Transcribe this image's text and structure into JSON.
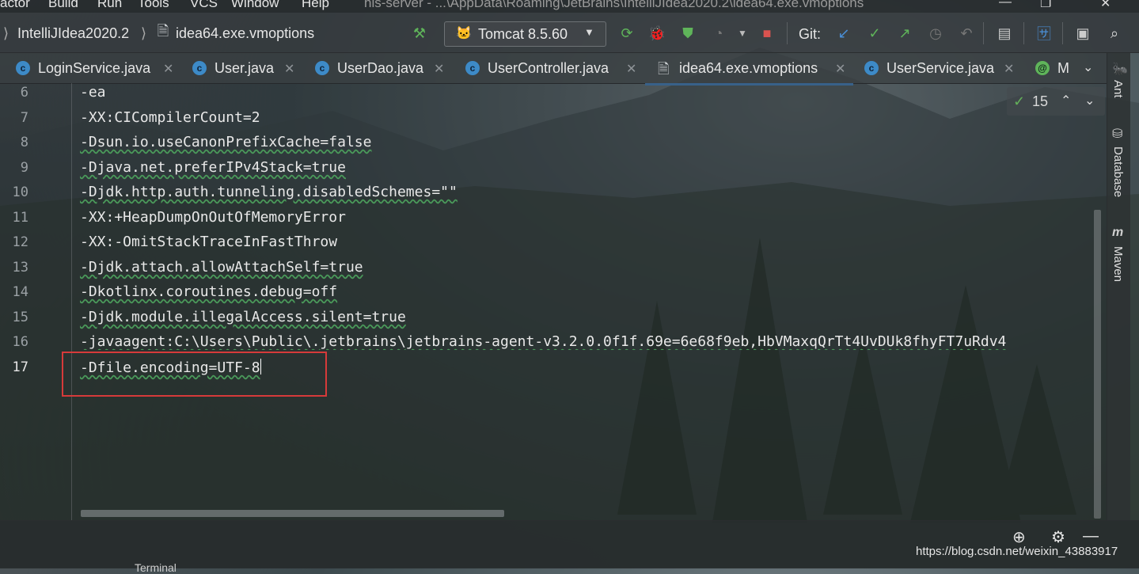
{
  "window": {
    "title": "his-server - ...\\AppData\\Roaming\\JetBrains\\IntelliJIdea2020.2\\idea64.exe.vmoptions",
    "menu": [
      "actor",
      "Build",
      "Run",
      "Tools",
      "VCS",
      "Window",
      "Help"
    ],
    "controls": {
      "minimize": "—",
      "restore": "❐",
      "close": "✕"
    }
  },
  "navbar": {
    "breadcrumb": [
      "IntelliJIdea2020.2",
      "idea64.exe.vmoptions"
    ],
    "run_config": "Tomcat 8.5.60",
    "git_label": "Git:"
  },
  "tabs": [
    {
      "label": "LoginService.java",
      "icon": "class-icon"
    },
    {
      "label": "User.java",
      "icon": "class-icon"
    },
    {
      "label": "UserDao.java",
      "icon": "class-icon"
    },
    {
      "label": "UserController.java",
      "icon": "class-icon"
    },
    {
      "label": "idea64.exe.vmoptions",
      "icon": "file-icon",
      "active": true
    },
    {
      "label": "UserService.java",
      "icon": "class-icon"
    },
    {
      "label": "M",
      "icon": "annotation-icon"
    }
  ],
  "right_tools": [
    "Ant",
    "Database",
    "Maven"
  ],
  "inspection": {
    "count": "15"
  },
  "editor": {
    "lines": [
      {
        "num": "6",
        "text": "-ea"
      },
      {
        "num": "7",
        "text": "-XX:CICompilerCount=2"
      },
      {
        "num": "8",
        "text": "-Dsun.io.useCanonPrefixCache=false"
      },
      {
        "num": "9",
        "text": "-Djava.net.preferIPv4Stack=true"
      },
      {
        "num": "10",
        "text": "-Djdk.http.auth.tunneling.disabledSchemes=\"\""
      },
      {
        "num": "11",
        "text": "-XX:+HeapDumpOnOutOfMemoryError"
      },
      {
        "num": "12",
        "text": "-XX:-OmitStackTraceInFastThrow"
      },
      {
        "num": "13",
        "text": "-Djdk.attach.allowAttachSelf=true"
      },
      {
        "num": "14",
        "text": "-Dkotlinx.coroutines.debug=off"
      },
      {
        "num": "15",
        "text": "-Djdk.module.illegalAccess.silent=true"
      },
      {
        "num": "16",
        "text": "-javaagent:C:\\Users\\Public\\.jetbrains\\jetbrains-agent-v3.2.0.0f1f.69e=6e68f9eb,HbVMaxqQrTt4UvDUk8fhyFT7uRdv4"
      },
      {
        "num": "17",
        "text": "-Dfile.encoding=UTF-8"
      }
    ]
  },
  "bottom": {
    "watermark": "https://blog.csdn.net/weixin_43883917",
    "tool_label": "Terminal"
  },
  "colors": {
    "accent": "#4a88c7",
    "highlight": "#d63a3a",
    "ok": "#63b05a"
  }
}
